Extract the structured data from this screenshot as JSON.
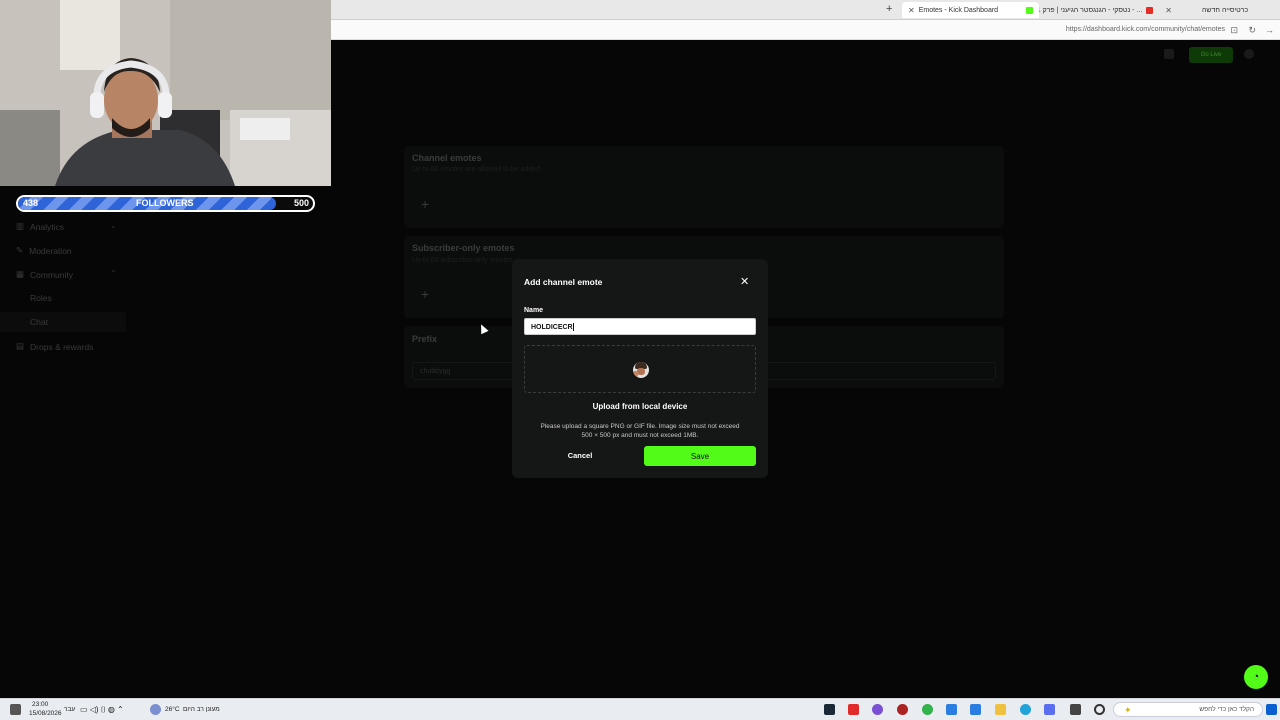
{
  "browser": {
    "tabs": [
      {
        "label": "Emotes - Kick Dashboard",
        "active": true
      },
      {
        "label": "נטסקי - הגנגסטר הגיעני | פרק 1 - ...",
        "active": false
      },
      {
        "label": "כרטיסייה חדשה",
        "active": false
      }
    ],
    "url": "https://dashboard.kick.com/community/chat/emotes"
  },
  "overlay": {
    "followers_current": "438",
    "followers_label": "FOLLOWERS",
    "followers_goal": "500",
    "progress_fraction": 0.876
  },
  "header": {
    "status_button": "Go Live"
  },
  "sidebar": {
    "items": [
      {
        "label": "Analytics"
      },
      {
        "label": "Moderation"
      },
      {
        "label": "Community"
      },
      {
        "label": "Roles"
      },
      {
        "label": "Chat"
      },
      {
        "label": "Drops & rewards"
      }
    ]
  },
  "content": {
    "channel_emotes_title": "Channel emotes",
    "channel_emotes_sub": "Up to 60 emotes are allowed to be added",
    "subscriber_emotes_title": "Subscriber-only emotes",
    "subscriber_emotes_sub": "Up to 60 subscriber-only emotes",
    "prefix_title": "Prefix",
    "prefix_value": "chubbygg",
    "add_symbol": "+"
  },
  "modal": {
    "title": "Add channel emote",
    "close_symbol": "✕",
    "name_label": "Name",
    "name_value": "HOLDICECR",
    "upload_label": "Upload from local device",
    "help_line1": "Please upload a square PNG or GIF file. Image size must not exceed",
    "help_line2": "500 × 500 px and must not exceed 1MB.",
    "cancel_label": "Cancel",
    "save_label": "Save"
  },
  "taskbar": {
    "time": "23:00",
    "date": "15/08/2026",
    "lang": "עבר",
    "weather_temp": "26°C",
    "weather_text": "מעונן רב היום",
    "search_placeholder": "הקלד כאן כדי לחפש"
  },
  "colors": {
    "accent_green": "#53fc18",
    "follow_blue": "#2f63d8",
    "modal_bg": "#151616"
  }
}
